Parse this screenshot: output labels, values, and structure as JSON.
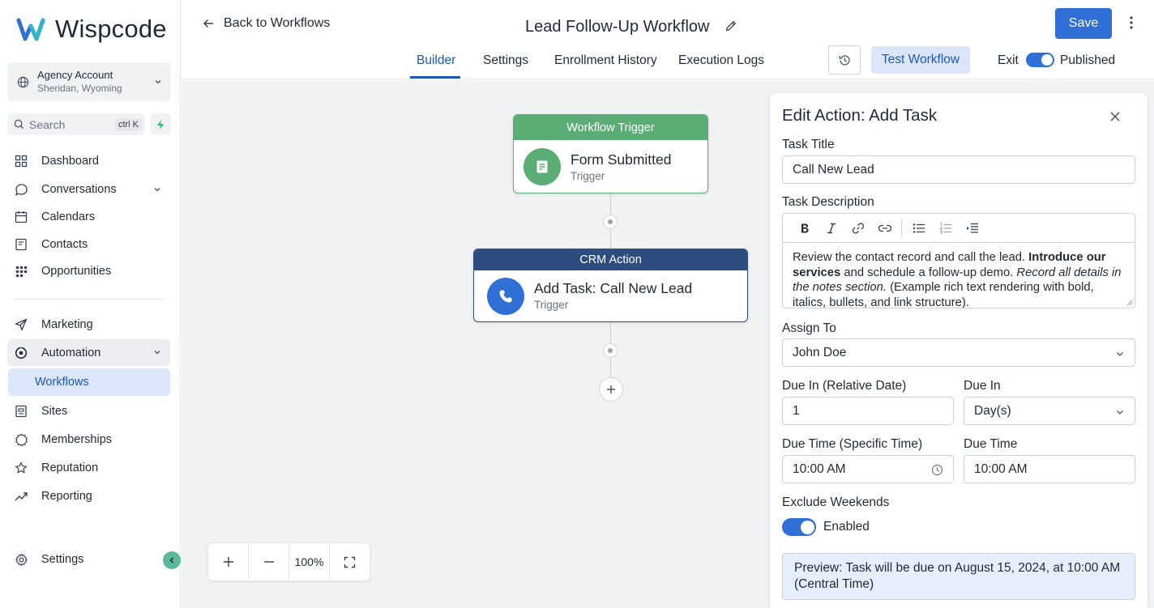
{
  "brand": {
    "name": "Wispcode"
  },
  "account": {
    "name": "Agency Account",
    "location": "Sheridan, Wyoming"
  },
  "search": {
    "placeholder": "Search",
    "shortcut": "ctrl K"
  },
  "sidebar": {
    "items": [
      {
        "label": "Dashboard",
        "icon": "dashboard-icon"
      },
      {
        "label": "Conversations",
        "icon": "chat-icon"
      },
      {
        "label": "Calendars",
        "icon": "calendar-icon"
      },
      {
        "label": "Contacts",
        "icon": "contacts-icon"
      },
      {
        "label": "Opportunities",
        "icon": "opportunities-icon"
      },
      {
        "label": "Marketing",
        "icon": "send-icon"
      },
      {
        "label": "Automation",
        "icon": "automation-icon"
      },
      {
        "label": "Workflows",
        "icon": ""
      },
      {
        "label": "Sites",
        "icon": "sites-icon"
      },
      {
        "label": "Memberships",
        "icon": "memberships-icon"
      },
      {
        "label": "Reputation",
        "icon": "star-icon"
      },
      {
        "label": "Reporting",
        "icon": "trend-icon"
      },
      {
        "label": "Settings",
        "icon": "gear-icon"
      }
    ]
  },
  "header": {
    "back_label": "Back to Workflows",
    "title": "Lead Follow-Up Workflow",
    "tabs": [
      "Builder",
      "Settings",
      "Enrollment History",
      "Execution Logs"
    ],
    "active_tab": "Builder",
    "save_label": "Save",
    "test_label": "Test Workflow",
    "exit_label": "Exit",
    "published_label": "Published"
  },
  "canvas": {
    "trigger_node": {
      "header": "Workflow Trigger",
      "title": "Form Submitted",
      "subtitle": "Trigger",
      "color": "#5aad75"
    },
    "action_node": {
      "header": "CRM Action",
      "title": "Add Task: Call New Lead",
      "subtitle": "Trigger",
      "color": "#2d4d80"
    },
    "zoom": "100%"
  },
  "panel": {
    "title": "Edit Action: Add Task",
    "task_title_label": "Task Title",
    "task_title_value": "Call New Lead",
    "task_desc_label": "Task Description",
    "task_desc": {
      "p1": "Review the contact record and call the lead. ",
      "b1": "Introduce our services",
      "p2": " and schedule a follow-up demo. ",
      "i1": "Record all details in the notes section.",
      "p3": " (Example rich text rendering with bold, italics, bullets, and link structure)."
    },
    "assign_label": "Assign To",
    "assign_value": "John Doe",
    "due_rel_label": "Due In (Relative Date)",
    "due_rel_value": "1",
    "due_in_label": "Due In",
    "due_in_value": "Day(s)",
    "due_time_specific_label": "Due Time (Specific Time)",
    "due_time_specific_value": "10:00 AM",
    "due_time_label": "Due Time",
    "due_time_value": "10:00 AM",
    "exclude_label": "Exclude Weekends",
    "exclude_state": "Enabled",
    "preview": "Preview: Task will be due on August 15, 2024, at 10:00 AM (Central Time)"
  },
  "colors": {
    "primary": "#2f6fd6",
    "accent_light": "#dbe6fb",
    "trigger_green": "#5aad75",
    "action_navy": "#2d4d80"
  }
}
